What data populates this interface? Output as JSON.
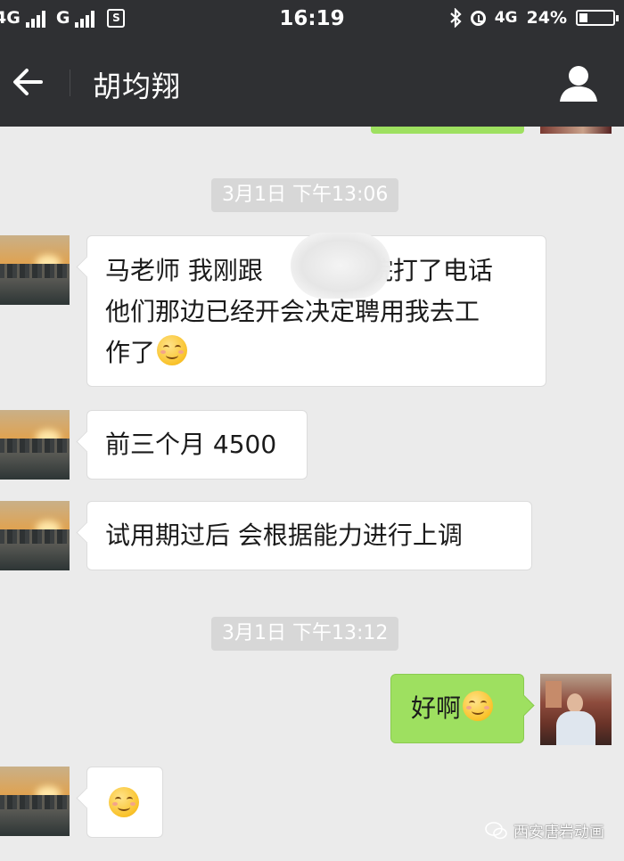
{
  "status_bar": {
    "network_1": "4G",
    "network_2": "G",
    "sim_badge": "S",
    "time": "16:19",
    "network_3": "4G",
    "battery": "24%",
    "battery_level": 0.24
  },
  "header": {
    "title": "胡均翔",
    "icons": {
      "back": "back-arrow-icon",
      "profile": "profile-icon"
    }
  },
  "messages": [
    {
      "type": "timestamp",
      "text": "3月1日 下午13:06"
    },
    {
      "type": "incoming",
      "lines": [
        "马老师  我刚跟",
        "院打了电话",
        "他们那边已经开会决定聘用我去工",
        "作了"
      ],
      "emoji": "smile-emoji"
    },
    {
      "type": "incoming",
      "lines": [
        "前三个月 4500"
      ]
    },
    {
      "type": "incoming",
      "lines": [
        "试用期过后 会根据能力进行上调"
      ]
    },
    {
      "type": "timestamp",
      "text": "3月1日 下午13:12"
    },
    {
      "type": "outgoing",
      "lines": [
        "好啊"
      ],
      "emoji": "smile-emoji"
    },
    {
      "type": "incoming",
      "lines": [],
      "emoji": "smile-emoji"
    }
  ],
  "watermark": "西安唐岩动画",
  "colors": {
    "header_bg": "#2f3033",
    "chat_bg": "#ebebeb",
    "outgoing_bubble": "#9ee060",
    "incoming_bubble": "#ffffff",
    "timestamp_bg": "#d7d7d7"
  }
}
